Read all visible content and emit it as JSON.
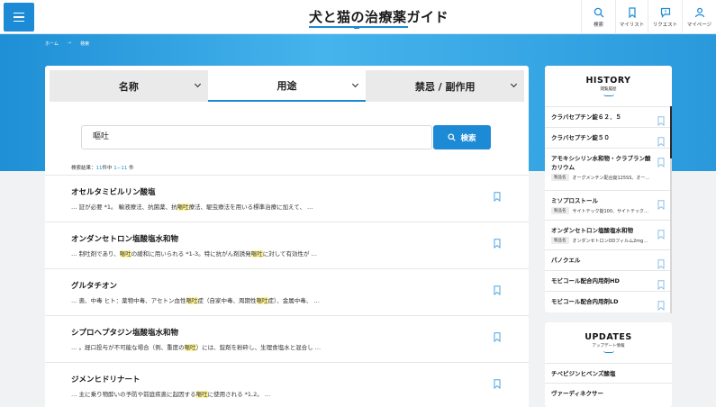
{
  "header": {
    "logo": "犬と猫の治療薬ガイド",
    "nav": [
      {
        "label": "検索",
        "icon": "search-icon"
      },
      {
        "label": "マイリスト",
        "icon": "bookmark-icon"
      },
      {
        "label": "リクエスト",
        "icon": "chat-icon"
      },
      {
        "label": "マイページ",
        "icon": "user-icon"
      }
    ]
  },
  "breadcrumb": [
    "ホーム",
    "→",
    "検索"
  ],
  "tabs": [
    {
      "label": "名称",
      "active": false
    },
    {
      "label": "用途",
      "active": true
    },
    {
      "label": "禁忌 / 副作用",
      "active": false
    }
  ],
  "search": {
    "value": "嘔吐",
    "button_label": "検索"
  },
  "result_count": {
    "prefix": "検索結果：",
    "total": "11",
    "mid": "件中",
    "range": "1−11",
    "suffix": "件"
  },
  "results": [
    {
      "title": "オセルタミビルリン酸塩",
      "snippet": [
        [
          "… 証が必要 *1。 輸液療法、抗菌薬、抗",
          false
        ],
        [
          "嘔吐",
          true
        ],
        [
          "療法、駆虫療法を用いる標準治療に加えて、 …",
          false
        ]
      ]
    },
    {
      "title": "オンダンセトロン塩酸塩水和物",
      "snippet": [
        [
          "… 制吐剤であり、",
          false
        ],
        [
          "嘔吐",
          true
        ],
        [
          "の緩和に用いられる *1-3。特に抗がん剤誘発",
          false
        ],
        [
          "嘔吐",
          true
        ],
        [
          "に対して有効性が …",
          false
        ]
      ]
    },
    {
      "title": "グルタチオン",
      "snippet": [
        [
          "… 患、中毒 ヒト：薬物中毒、アセトン血性",
          false
        ],
        [
          "嘔吐",
          true
        ],
        [
          "症（自家中毒、周期性",
          false
        ],
        [
          "嘔吐",
          true
        ],
        [
          "症）、金属中毒、 …",
          false
        ]
      ]
    },
    {
      "title": "シプロヘプタジン塩酸塩水和物",
      "snippet": [
        [
          "… 。経口投与が不可能な場合（例、重度の",
          false
        ],
        [
          "嘔吐",
          true
        ],
        [
          "）には、錠剤を粉砕し、生理食塩水と混合し …",
          false
        ]
      ]
    },
    {
      "title": "ジメンヒドリナート",
      "snippet": [
        [
          "… 主に乗り物酔いの予防や前庭疾患に起因する",
          false
        ],
        [
          "嘔吐",
          true
        ],
        [
          "に使用される *1,2。 …",
          false
        ]
      ]
    }
  ],
  "history": {
    "title": "HISTORY",
    "subtitle": "閲覧履歴",
    "items": [
      {
        "name": "クラバセプチン錠６２．５"
      },
      {
        "name": "クラバセプチン錠５０"
      },
      {
        "name": "アモキシシリン水和物・クラブラン酸カリウム",
        "badge": "製品名",
        "detail": "オーグメンチン配合錠125SS、オー…"
      },
      {
        "name": "ミソプロストール",
        "badge": "製品名",
        "detail": "サイトテック錠100、サイトテック…"
      },
      {
        "name": "オンダンセトロン塩酸塩水和物",
        "badge": "製品名",
        "detail": "オンダンセトロンODフィルム2mg…"
      },
      {
        "name": "パノクエル"
      },
      {
        "name": "モビコール配合内用剤HD"
      },
      {
        "name": "モビコール配合内用剤LD"
      }
    ]
  },
  "updates": {
    "title": "UPDATES",
    "subtitle": "アップデート情報",
    "items": [
      "チペピジンヒベンズ酸塩",
      "ヴァーディネクサー"
    ]
  },
  "colors": {
    "accent": "#1c8ad4",
    "highlight": "#fff59a"
  }
}
